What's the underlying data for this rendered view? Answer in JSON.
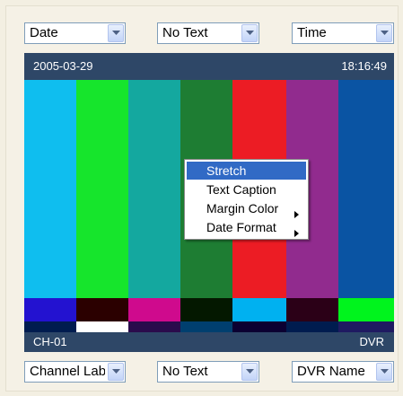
{
  "top_controls": {
    "left_select": {
      "value": "Date"
    },
    "center_select": {
      "value": "No Text"
    },
    "right_select": {
      "value": "Time"
    }
  },
  "preview": {
    "top_left_text": "2005-03-29",
    "top_right_text": "18:16:49",
    "bottom_left_text": "CH-01",
    "bottom_right_text": "DVR",
    "colors": {
      "bar_top": [
        "#0fbeef",
        "#16e52c",
        "#14a89f",
        "#1e7d33",
        "#ec1c24",
        "#912b8e",
        "#0a54a3"
      ],
      "bar_mid": [
        "#2312d0",
        "#2b0000",
        "#cf0a8d",
        "#041800",
        "#00b1f0",
        "#2b0017",
        "#00f41d"
      ],
      "bar_bottom": [
        "#001c4f",
        "#ffffff",
        "#2a0b4c",
        "#003f6f",
        "#0b0032",
        "#001c4f",
        "#1f1a61"
      ]
    }
  },
  "context_menu": {
    "items": [
      {
        "label": "Stretch",
        "selected": true,
        "submenu": false
      },
      {
        "label": "Text Caption",
        "selected": false,
        "submenu": false
      },
      {
        "label": "Margin Color",
        "selected": false,
        "submenu": true
      },
      {
        "label": "Date Format",
        "selected": false,
        "submenu": true
      }
    ]
  },
  "bottom_controls": {
    "left_select": {
      "value": "Channel Lab"
    },
    "center_select": {
      "value": "No Text"
    },
    "right_select": {
      "value": "DVR Name"
    }
  }
}
